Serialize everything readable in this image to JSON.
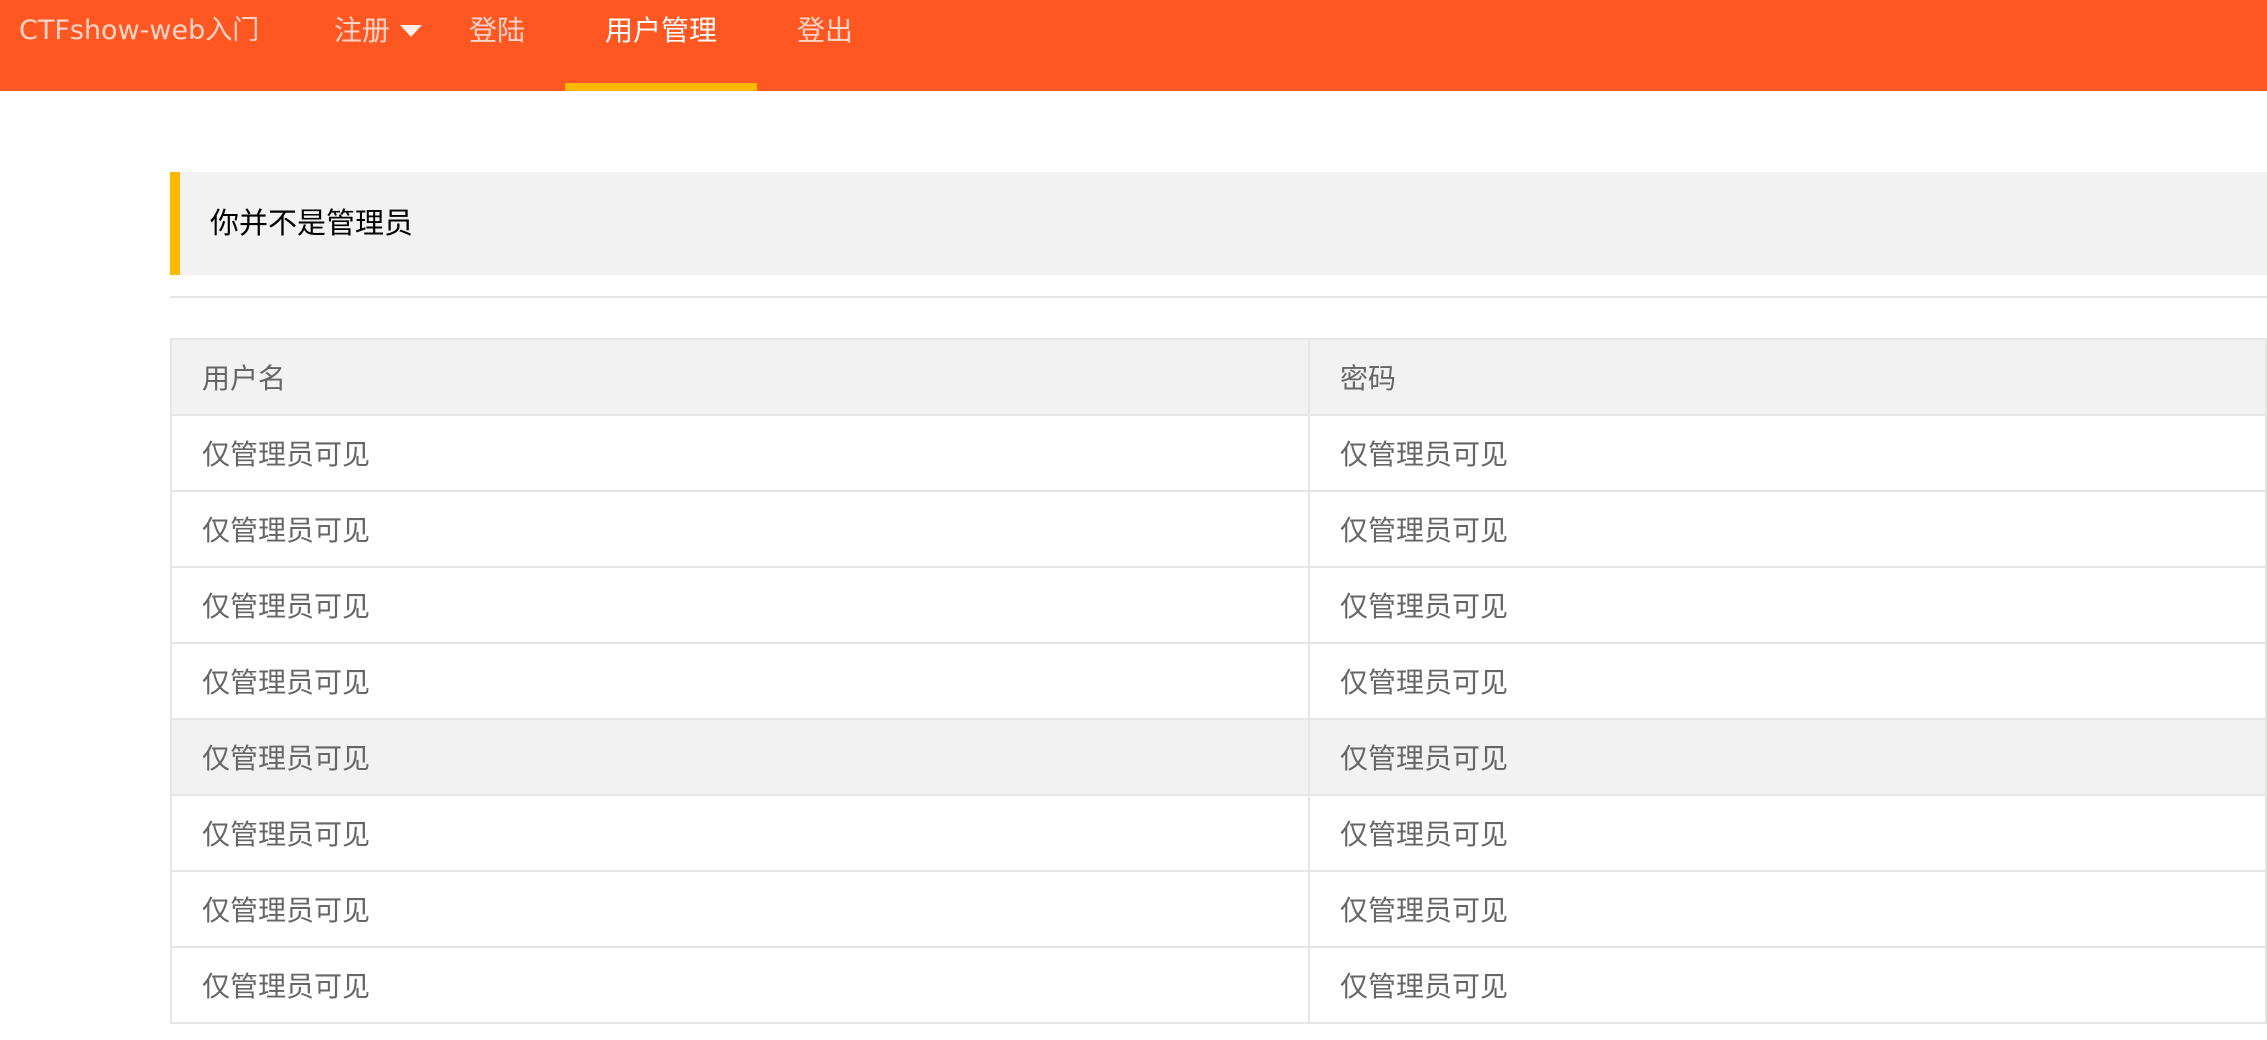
{
  "header": {
    "brand": "CTFshow-web入门",
    "nav": [
      {
        "label": "注册",
        "has_dropdown": true
      },
      {
        "label": "登陆"
      },
      {
        "label": "用户管理",
        "active": true
      },
      {
        "label": "登出"
      }
    ]
  },
  "notice": {
    "text": "你并不是管理员"
  },
  "table": {
    "columns": [
      "用户名",
      "密码"
    ],
    "rows": [
      [
        "仅管理员可见",
        "仅管理员可见"
      ],
      [
        "仅管理员可见",
        "仅管理员可见"
      ],
      [
        "仅管理员可见",
        "仅管理员可见"
      ],
      [
        "仅管理员可见",
        "仅管理员可见"
      ],
      [
        "仅管理员可见",
        "仅管理员可见"
      ],
      [
        "仅管理员可见",
        "仅管理员可见"
      ],
      [
        "仅管理员可见",
        "仅管理员可见"
      ],
      [
        "仅管理员可见",
        "仅管理员可见"
      ]
    ],
    "highlighted_row": 5
  },
  "colors": {
    "header_bg": "#ff5722",
    "active_underline": "#ffb800",
    "notice_bg": "#f2f2f2",
    "notice_border": "#ffb800",
    "table_border": "#e6e6e6",
    "text_muted": "#666666"
  },
  "icons": {
    "dropdown": "caret-down-icon"
  }
}
